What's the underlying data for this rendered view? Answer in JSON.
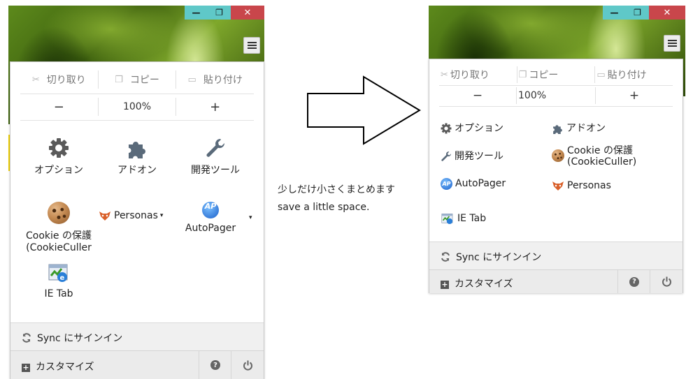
{
  "window_buttons": {
    "minimize": "—",
    "restore": "❐",
    "close": "✕"
  },
  "left_panel": {
    "edit": {
      "cut": "切り取り",
      "copy": "コピー",
      "paste": "貼り付け"
    },
    "zoom": {
      "minus": "−",
      "level": "100%",
      "plus": "+"
    },
    "items": {
      "options": "オプション",
      "addons": "アドオン",
      "devtools": "開発ツール",
      "cookie_line1": "Cookie の保護",
      "cookie_line2": "(CookieCuller",
      "personas": "Personas",
      "autopager": "AutoPager",
      "ietab": "IE Tab"
    },
    "sync": "Sync にサインイン",
    "customize": "カスタマイズ"
  },
  "caption": {
    "line1": "少しだけ小さくまとめます",
    "line2": "save a little space."
  },
  "right_panel": {
    "edit": {
      "cut": "切り取り",
      "copy": "コピー",
      "paste": "貼り付け"
    },
    "zoom": {
      "minus": "−",
      "level": "100%",
      "plus": "+"
    },
    "items": {
      "options": "オプション",
      "addons": "アドオン",
      "devtools": "開発ツール",
      "cookie_line1": "Cookie の保護",
      "cookie_line2": "(CookieCuller)",
      "autopager": "AutoPager",
      "personas": "Personas",
      "ietab": "IE Tab"
    },
    "sync": "Sync にサインイン",
    "customize": "カスタマイズ"
  },
  "colors": {
    "theme_green": "#5d8a1c",
    "close_red": "#c9464b",
    "window_cyan": "#5fc8c8"
  }
}
